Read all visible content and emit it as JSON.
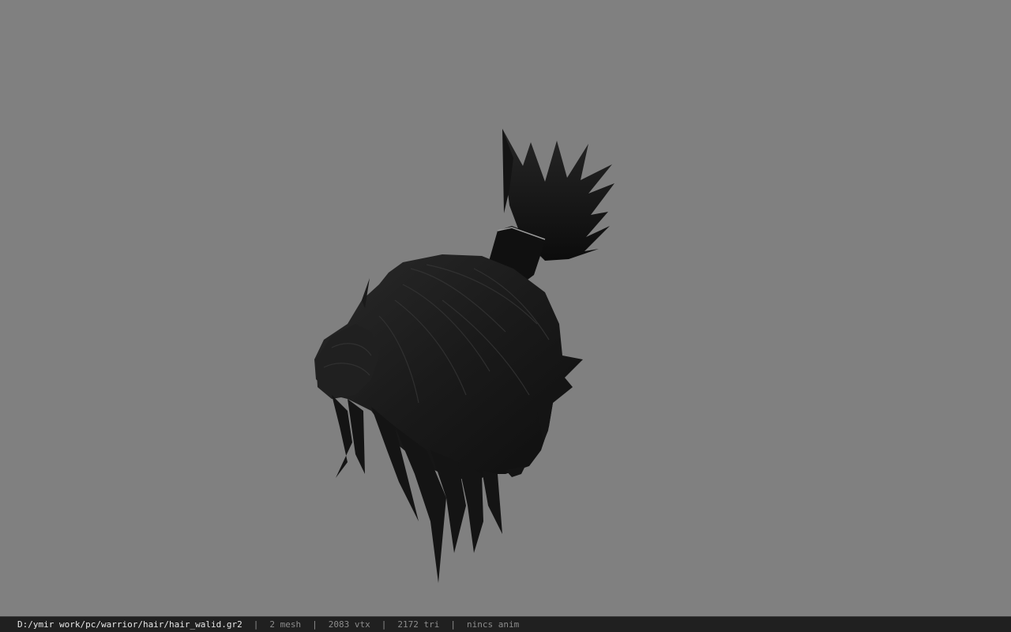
{
  "viewport": {
    "background_color": "#808080",
    "model_color": "#1c1c1c",
    "model_name": "hair-model"
  },
  "statusbar": {
    "path": "D:/ymir work/pc/warrior/hair/hair_walid.gr2",
    "separator": "|",
    "meshes": "2 mesh",
    "vertices": "2083 vtx",
    "triangles": "2172 tri",
    "animation": "nincs anim"
  }
}
